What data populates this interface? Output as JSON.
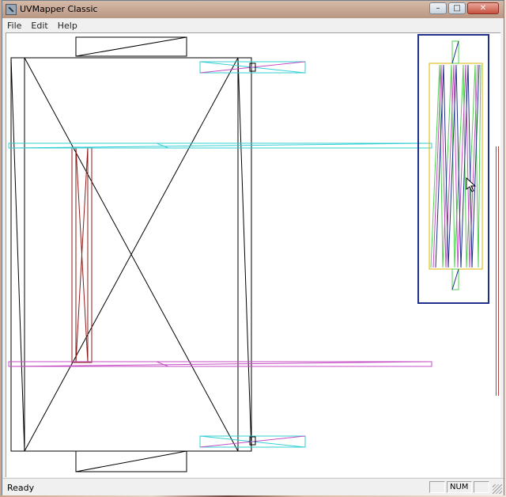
{
  "window": {
    "title": "UVMapper Classic"
  },
  "title_buttons": {
    "minimize": "–",
    "maximize": "□",
    "close": "✕"
  },
  "menu": {
    "items": [
      "File",
      "Edit",
      "Help"
    ]
  },
  "status": {
    "message": "Ready",
    "indicator": "NUM"
  },
  "colors": {
    "mesh_black": "#000000",
    "mesh_cyan": "#35cfd6",
    "mesh_magenta": "#c44fc4",
    "mesh_darkred": "#8b1a1a",
    "selection_blue": "#1f2f8a",
    "mesh_yellow": "#e0b400",
    "mesh_green": "#4cd04c"
  }
}
